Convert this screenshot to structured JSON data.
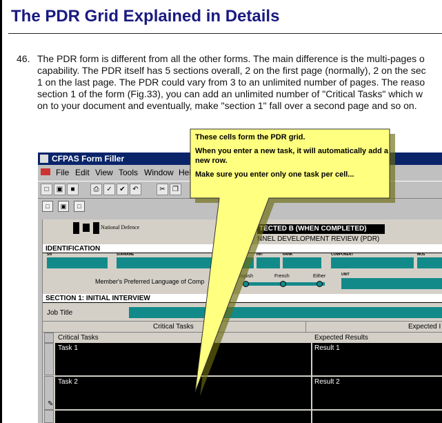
{
  "page": {
    "title": "The PDR Grid Explained in Details",
    "paragraph_number": "46.",
    "paragraph_lines": [
      "The PDR form is different from all the other forms. The main difference is the multi-pages o",
      "capability. The PDR itself has 5 sections overall, 2 on the first page (normally), 2 on the sec",
      "1 on the last page. The PDR could vary from 3 to an unlimited number of pages. The reaso",
      "section 1 of the form (Fig.33), you can add an unlimited number of \"Critical Tasks\" which w",
      "on to your document and eventually, make \"section 1\" fall over a second page and so on."
    ]
  },
  "callout": {
    "line1": "These cells form the PDR grid.",
    "line2": "When you enter a new task, it will automatically add a new row.",
    "line3": "Make sure you enter only one task per cell..."
  },
  "app": {
    "title": "CFPAS Form Filler",
    "menu": [
      "File",
      "Edit",
      "View",
      "Tools",
      "Window",
      "Hel"
    ],
    "form": {
      "national_defence": "National Defence",
      "protected": "TECTED B (WHEN COMPLETED)",
      "personnel": "NNEL DEVELOPMENT REVIEW (PDR)",
      "identification": "IDENTIFICATION",
      "fields": [
        "SN",
        "SURNAME",
        "INIT",
        "RANK",
        "COMPONENT",
        "MOS"
      ],
      "language_label": "Member's Preferred Language of Comp",
      "lang_options": [
        "English",
        "French",
        "Either"
      ],
      "unit_label": "UNIT",
      "section1": "SECTION 1:  INITIAL INTERVIEW",
      "job_title": "Job Title",
      "critical_tasks_header": "Critical Tasks",
      "expected_header": "Expected I",
      "col_critical": "Critical Tasks",
      "col_expected": "Expected Results",
      "rows": [
        {
          "task": "Task 1",
          "result": "Result 1"
        },
        {
          "task": "Task 2",
          "result": "Result 2"
        }
      ]
    }
  },
  "colors": {
    "title": "#1a1a80",
    "teal": "#138a8a",
    "callout_fill": "#ffff80",
    "titlebar": "#0a246a"
  }
}
